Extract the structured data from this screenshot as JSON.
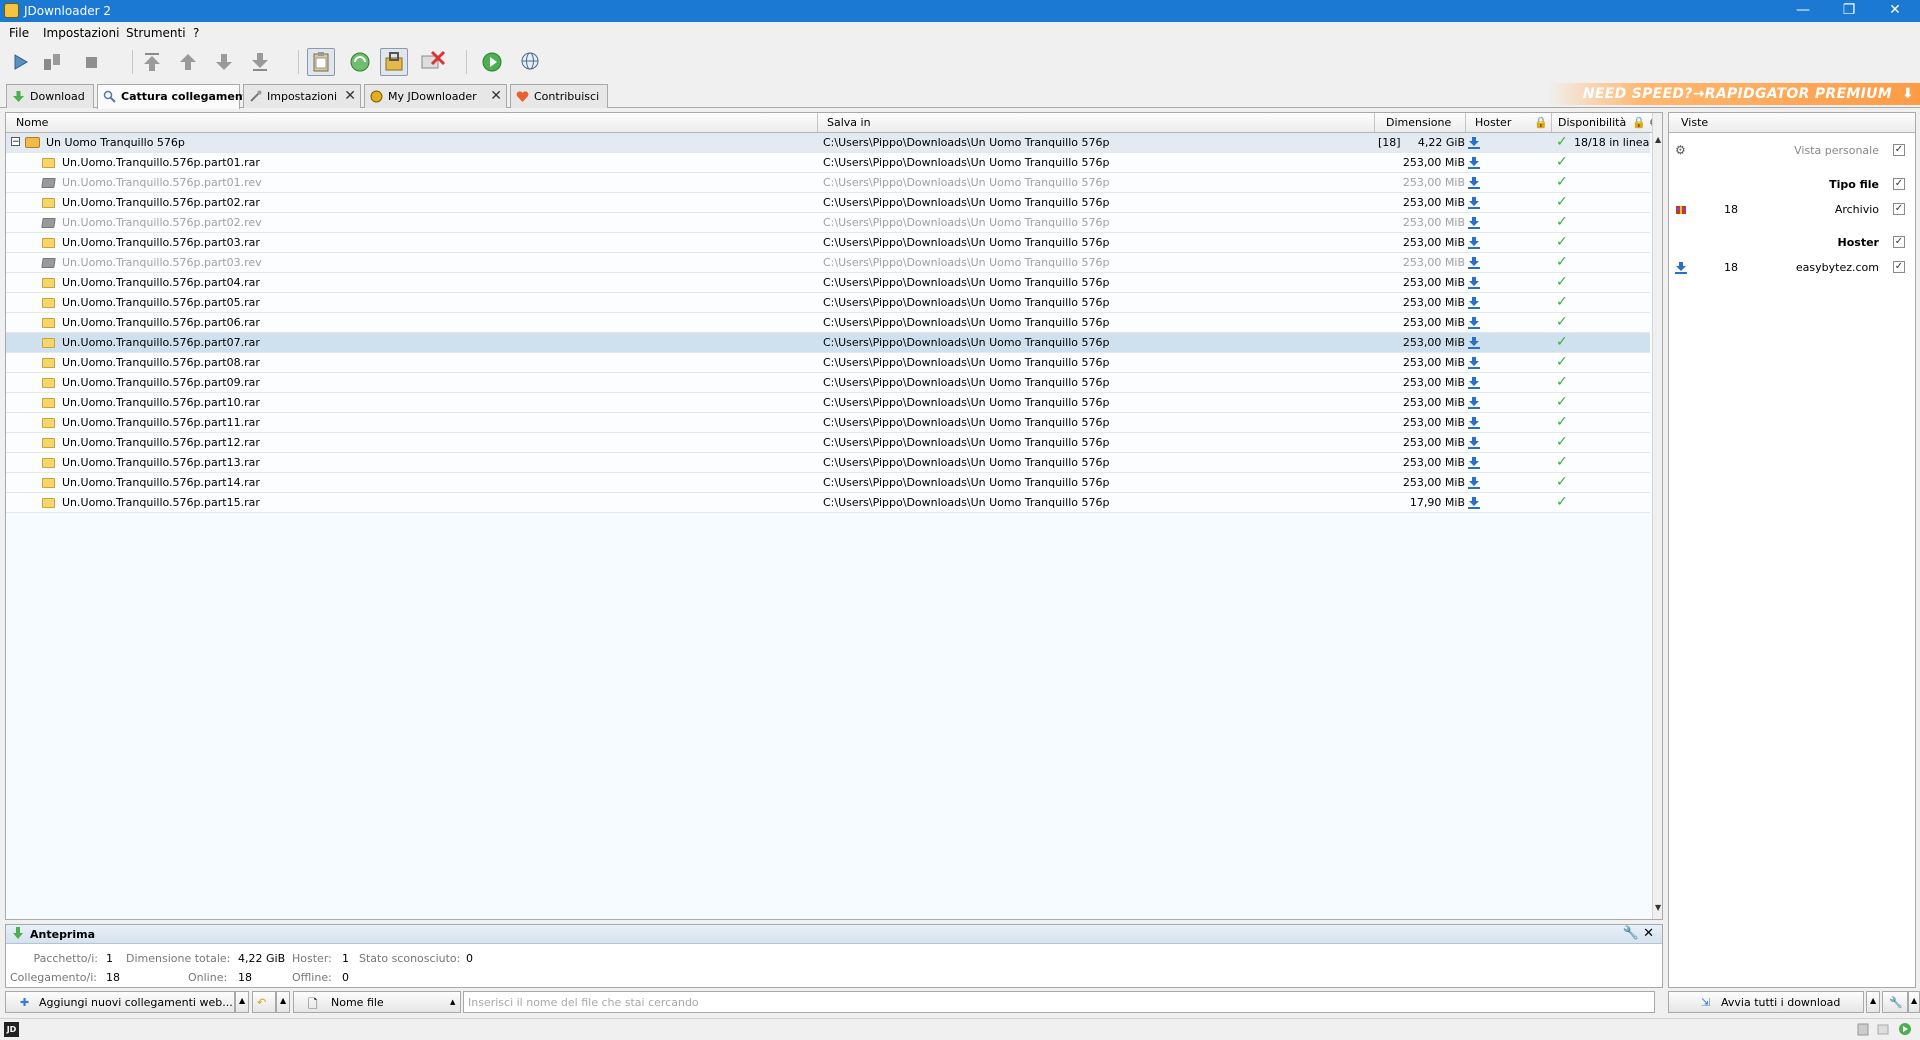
{
  "window": {
    "title": "JDownloader 2",
    "min_glyph": "—",
    "max_glyph": "❐",
    "close_glyph": "✕"
  },
  "menu": [
    "File",
    "Impostazioni",
    "Strumenti",
    "?"
  ],
  "tabs": [
    {
      "label": "Download",
      "icon": "download-arrow-icon",
      "closable": false,
      "active": false
    },
    {
      "label": "Cattura collegamenti",
      "icon": "linkgrabber-icon",
      "closable": false,
      "active": true
    },
    {
      "label": "Impostazioni",
      "icon": "settings-tools-icon",
      "closable": true,
      "active": false
    },
    {
      "label": "My JDownloader",
      "icon": "myjd-icon",
      "closable": true,
      "active": false
    },
    {
      "label": "Contribuisci",
      "icon": "heart-icon",
      "closable": false,
      "active": false
    }
  ],
  "promo": {
    "text": "NEED SPEED?→RAPIDGATOR PREMIUM"
  },
  "table": {
    "columns": [
      "Nome",
      "Salva in",
      "Dimensione",
      "Hoster",
      "Disponibilità"
    ],
    "package": {
      "name": "Un Uomo Tranquillo 576p",
      "path": "C:\\Users\\Pippo\\Downloads\\Un Uomo Tranquillo 576p",
      "count": "[18]",
      "size": "4,22 GiB",
      "availability": "18/18 in linea"
    },
    "rows": [
      {
        "name": "Un.Uomo.Tranquillo.576p.part01.rar",
        "path": "C:\\Users\\Pippo\\Downloads\\Un Uomo Tranquillo 576p",
        "size": "253,00 MiB",
        "type": "rar",
        "disabled": false,
        "selected": false
      },
      {
        "name": "Un.Uomo.Tranquillo.576p.part01.rev",
        "path": "C:\\Users\\Pippo\\Downloads\\Un Uomo Tranquillo 576p",
        "size": "253,00 MiB",
        "type": "rev",
        "disabled": true,
        "selected": false
      },
      {
        "name": "Un.Uomo.Tranquillo.576p.part02.rar",
        "path": "C:\\Users\\Pippo\\Downloads\\Un Uomo Tranquillo 576p",
        "size": "253,00 MiB",
        "type": "rar",
        "disabled": false,
        "selected": false
      },
      {
        "name": "Un.Uomo.Tranquillo.576p.part02.rev",
        "path": "C:\\Users\\Pippo\\Downloads\\Un Uomo Tranquillo 576p",
        "size": "253,00 MiB",
        "type": "rev",
        "disabled": true,
        "selected": false
      },
      {
        "name": "Un.Uomo.Tranquillo.576p.part03.rar",
        "path": "C:\\Users\\Pippo\\Downloads\\Un Uomo Tranquillo 576p",
        "size": "253,00 MiB",
        "type": "rar",
        "disabled": false,
        "selected": false
      },
      {
        "name": "Un.Uomo.Tranquillo.576p.part03.rev",
        "path": "C:\\Users\\Pippo\\Downloads\\Un Uomo Tranquillo 576p",
        "size": "253,00 MiB",
        "type": "rev",
        "disabled": true,
        "selected": false
      },
      {
        "name": "Un.Uomo.Tranquillo.576p.part04.rar",
        "path": "C:\\Users\\Pippo\\Downloads\\Un Uomo Tranquillo 576p",
        "size": "253,00 MiB",
        "type": "rar",
        "disabled": false,
        "selected": false
      },
      {
        "name": "Un.Uomo.Tranquillo.576p.part05.rar",
        "path": "C:\\Users\\Pippo\\Downloads\\Un Uomo Tranquillo 576p",
        "size": "253,00 MiB",
        "type": "rar",
        "disabled": false,
        "selected": false
      },
      {
        "name": "Un.Uomo.Tranquillo.576p.part06.rar",
        "path": "C:\\Users\\Pippo\\Downloads\\Un Uomo Tranquillo 576p",
        "size": "253,00 MiB",
        "type": "rar",
        "disabled": false,
        "selected": false
      },
      {
        "name": "Un.Uomo.Tranquillo.576p.part07.rar",
        "path": "C:\\Users\\Pippo\\Downloads\\Un Uomo Tranquillo 576p",
        "size": "253,00 MiB",
        "type": "rar",
        "disabled": false,
        "selected": true
      },
      {
        "name": "Un.Uomo.Tranquillo.576p.part08.rar",
        "path": "C:\\Users\\Pippo\\Downloads\\Un Uomo Tranquillo 576p",
        "size": "253,00 MiB",
        "type": "rar",
        "disabled": false,
        "selected": false
      },
      {
        "name": "Un.Uomo.Tranquillo.576p.part09.rar",
        "path": "C:\\Users\\Pippo\\Downloads\\Un Uomo Tranquillo 576p",
        "size": "253,00 MiB",
        "type": "rar",
        "disabled": false,
        "selected": false
      },
      {
        "name": "Un.Uomo.Tranquillo.576p.part10.rar",
        "path": "C:\\Users\\Pippo\\Downloads\\Un Uomo Tranquillo 576p",
        "size": "253,00 MiB",
        "type": "rar",
        "disabled": false,
        "selected": false
      },
      {
        "name": "Un.Uomo.Tranquillo.576p.part11.rar",
        "path": "C:\\Users\\Pippo\\Downloads\\Un Uomo Tranquillo 576p",
        "size": "253,00 MiB",
        "type": "rar",
        "disabled": false,
        "selected": false
      },
      {
        "name": "Un.Uomo.Tranquillo.576p.part12.rar",
        "path": "C:\\Users\\Pippo\\Downloads\\Un Uomo Tranquillo 576p",
        "size": "253,00 MiB",
        "type": "rar",
        "disabled": false,
        "selected": false
      },
      {
        "name": "Un.Uomo.Tranquillo.576p.part13.rar",
        "path": "C:\\Users\\Pippo\\Downloads\\Un Uomo Tranquillo 576p",
        "size": "253,00 MiB",
        "type": "rar",
        "disabled": false,
        "selected": false
      },
      {
        "name": "Un.Uomo.Tranquillo.576p.part14.rar",
        "path": "C:\\Users\\Pippo\\Downloads\\Un Uomo Tranquillo 576p",
        "size": "253,00 MiB",
        "type": "rar",
        "disabled": false,
        "selected": false
      },
      {
        "name": "Un.Uomo.Tranquillo.576p.part15.rar",
        "path": "C:\\Users\\Pippo\\Downloads\\Un Uomo Tranquillo 576p",
        "size": "17,90 MiB",
        "type": "rar",
        "disabled": false,
        "selected": false
      }
    ]
  },
  "sidebar": {
    "title": "Viste",
    "personal_view": "Vista personale",
    "file_type_header": "Tipo file",
    "file_type_item": {
      "count": "18",
      "label": "Archivio"
    },
    "hoster_header": "Hoster",
    "hoster_item": {
      "count": "18",
      "label": "easybytez.com"
    }
  },
  "preview": {
    "title": "Anteprima",
    "stats": {
      "packages_label": "Pacchetto/i:",
      "packages": "1",
      "total_size_label": "Dimensione totale:",
      "total_size": "4,22 GiB",
      "hosters_label": "Hoster:",
      "hosters": "1",
      "unknown_label": "Stato sconosciuto:",
      "unknown": "0",
      "links_label": "Collegamento/i:",
      "links": "18",
      "online_label": "Online:",
      "online": "18",
      "offline_label": "Offline:",
      "offline": "0"
    }
  },
  "bottom": {
    "add_links_label": "Aggiungi nuovi collegamenti web...",
    "filter_type_label": "Nome file",
    "search_placeholder": "Inserisci il nome del file che stai cercando",
    "start_all_label": "Avvia tutti i download"
  },
  "colors": {
    "titlebar": "#1b78d3",
    "check": "#3cae3c",
    "selected_row": "#cfe1ee"
  }
}
